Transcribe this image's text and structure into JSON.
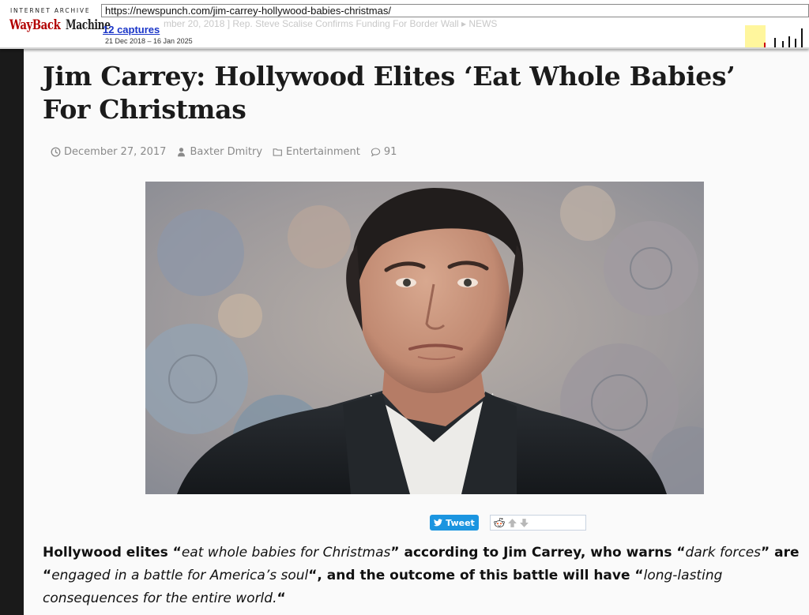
{
  "wayback": {
    "ia_label": "INTERNET ARCHIVE",
    "logo_part1": "WayBack",
    "logo_part2": "Machine",
    "url": "https://newspunch.com/jim-carrey-hollywood-babies-christmas/",
    "captures": "12 captures",
    "date_range": "21 Dec 2018 – 16 Jan 2025",
    "behind_text": "mber 20, 2018 ]  Rep. Steve Scalise Confirms Funding For Border Wall  ▸  NEWS"
  },
  "article": {
    "title": "Jim Carrey: Hollywood Elites ‘Eat Whole Babies’ For Christmas",
    "meta": {
      "date": "December 27, 2017",
      "author": "Baxter Dmitry",
      "category": "Entertainment",
      "comments": "91"
    },
    "share": {
      "tweet_label": "Tweet"
    },
    "lead": {
      "p1": "Hollywood elites “",
      "e1": "eat whole babies for Christmas",
      "p2": "” according to Jim Carrey, who warns “",
      "e2": "dark forces",
      "p3": "” are “",
      "e3": "engaged in a battle for America’s soul",
      "p4": "“, and the outcome of this battle will have “",
      "e4": "long-lasting consequences for the entire world.",
      "p5": "“"
    }
  },
  "colors": {
    "wayback_red": "#b20000",
    "link_blue": "#1a35c8",
    "tweet_blue": "#1b95e0",
    "meta_gray": "#8a8a8a"
  }
}
